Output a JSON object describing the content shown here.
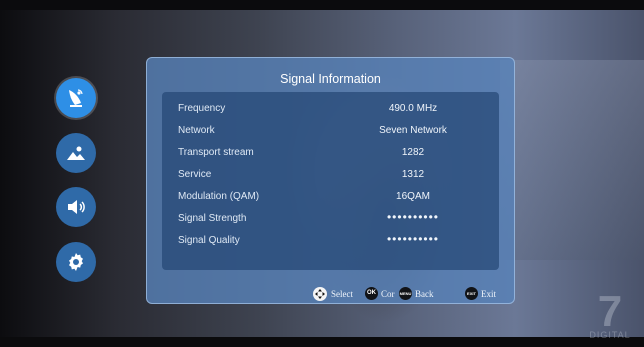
{
  "panel": {
    "title": "Signal Information"
  },
  "signal_info": [
    {
      "label": "Frequency",
      "value": "490.0 MHz"
    },
    {
      "label": "Network",
      "value": "Seven Network"
    },
    {
      "label": "Transport stream",
      "value": "1282"
    },
    {
      "label": "Service",
      "value": "1312"
    },
    {
      "label": "Modulation (QAM)",
      "value": "16QAM"
    },
    {
      "label": "Signal Strength",
      "value": "••••••••••"
    },
    {
      "label": "Signal Quality",
      "value": "••••••••••"
    }
  ],
  "footer": {
    "select_label": "Select",
    "ok_key": "OK",
    "ok_label": "Cor",
    "menu_key": "MENU",
    "back_label": "Back",
    "exit_key": "EXIT",
    "exit_label": "Exit"
  },
  "sidebar": {
    "icons": [
      "satellite-dish-icon",
      "picture-icon",
      "speaker-icon",
      "gear-icon"
    ],
    "active": "satellite-dish-icon"
  },
  "watermark": {
    "logo": "7",
    "text": "DIGITAL"
  },
  "colors": {
    "accent": "#2e8fe6",
    "panel": "#5882b9",
    "info_box": "#23467a"
  }
}
